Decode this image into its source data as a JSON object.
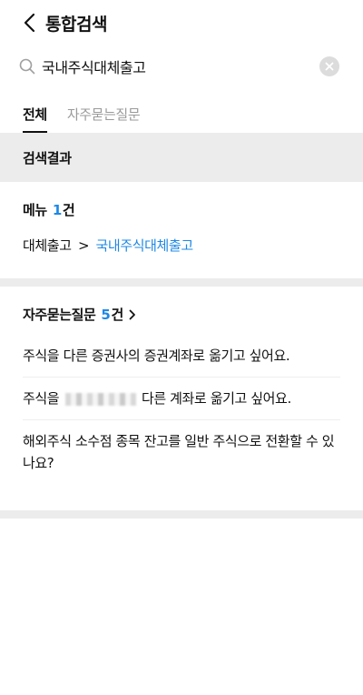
{
  "header": {
    "title": "통합검색",
    "back_icon": "chevron-left-icon"
  },
  "search": {
    "value": "국내주식대체출고",
    "search_icon": "search-icon",
    "clear_icon": "clear-icon"
  },
  "tabs": [
    {
      "label": "전체",
      "active": true
    },
    {
      "label": "자주묻는질문",
      "active": false
    }
  ],
  "results_header": "검색결과",
  "menu": {
    "title": "메뉴",
    "count": "1",
    "unit": "건",
    "path_parent": "대체출고",
    "path_sep": ">",
    "path_link": "국내주식대체출고"
  },
  "faq": {
    "title": "자주묻는질문",
    "count": "5",
    "unit": "건",
    "more_icon": "chevron-right-icon",
    "items": [
      {
        "text": "주식을 다른 증권사의 증권계좌로 옮기고 싶어요."
      },
      {
        "pre": "주식을",
        "post": "다른 계좌로 옮기고 싶어요."
      },
      {
        "text": "해외주식 소수점 종목 잔고를 일반 주식으로 전환할 수 있나요?"
      }
    ]
  },
  "colors": {
    "accent": "#1e88e5",
    "section_bg": "#ececec",
    "tab_inactive": "#9a9a9a"
  }
}
